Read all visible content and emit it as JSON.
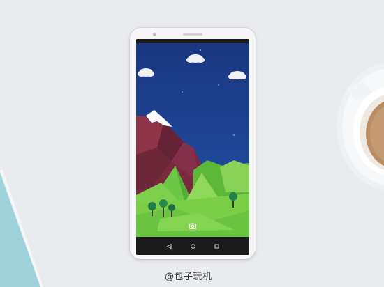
{
  "watermark": {
    "text": "@包子玩机"
  },
  "icons": {
    "camera_shortcut": "camera-icon",
    "nav_back": "back-triangle-icon",
    "nav_home": "home-circle-icon",
    "nav_recents": "recents-square-icon"
  },
  "colors": {
    "desk": "#e9ebef",
    "sky": "#1d3d8c",
    "grass": "#7ccf45",
    "mountain": "#7a2a3e",
    "phone_body": "#f6f6f6"
  }
}
